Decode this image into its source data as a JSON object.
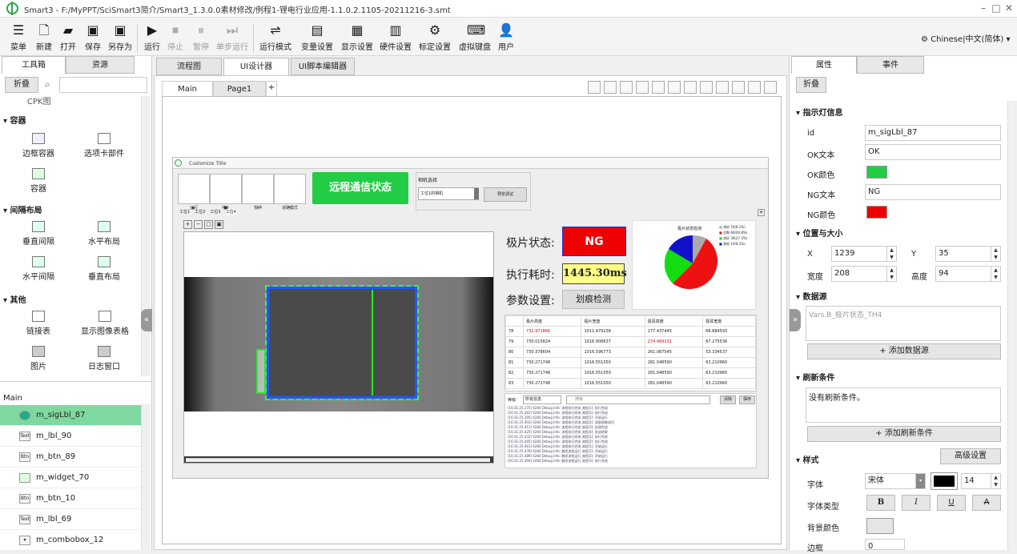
{
  "window": {
    "title": "Smart3 - F:/MyPPT/SciSmart3简介/Smart3_1.3.0.0素材修改/例程1-锂电行业应用-1.1.0.2.1105-20211216-3.smt"
  },
  "toolbar": [
    {
      "label": "菜单",
      "icon": "menu-icon"
    },
    {
      "label": "新建",
      "icon": "new-file-icon"
    },
    {
      "label": "打开",
      "icon": "folder-icon"
    },
    {
      "label": "保存",
      "icon": "save-icon"
    },
    {
      "label": "另存为",
      "icon": "save-as-icon"
    },
    {
      "label": "运行",
      "icon": "play-icon"
    },
    {
      "label": "停止",
      "icon": "stop-icon"
    },
    {
      "label": "暂停",
      "icon": "pause-icon"
    },
    {
      "label": "单步运行",
      "icon": "step-icon"
    },
    {
      "label": "运行模式",
      "icon": "run-mode-icon"
    },
    {
      "label": "变量设置",
      "icon": "var-icon"
    },
    {
      "label": "显示设置",
      "icon": "display-icon"
    },
    {
      "label": "硬件设置",
      "icon": "hardware-icon"
    },
    {
      "label": "标定设置",
      "icon": "calib-icon"
    },
    {
      "label": "虚拟键盘",
      "icon": "keyboard-icon"
    },
    {
      "label": "用户",
      "icon": "user-icon"
    }
  ],
  "language": "Chinese|中文(简体)",
  "left": {
    "tabs": [
      "工具箱",
      "资源"
    ],
    "fold_label": "折叠",
    "search_placeholder": "",
    "top_cut": "CPK图",
    "groups": [
      {
        "name": "容器",
        "items": [
          "边框容器",
          "选项卡部件",
          "容器"
        ]
      },
      {
        "name": "间隔布局",
        "items": [
          "垂直间隔",
          "水平布局",
          "水平间隔",
          "垂直布局"
        ]
      },
      {
        "name": "其他",
        "items": [
          "链接表",
          "显示图像表格",
          "图片",
          "日志窗口"
        ]
      }
    ],
    "layer_title": "Main",
    "layers": [
      {
        "name": "m_sigLbl_87",
        "type": "light",
        "selected": true
      },
      {
        "name": "m_lbl_90",
        "type": "Text",
        "selected": false
      },
      {
        "name": "m_btn_89",
        "type": "Button",
        "selected": false
      },
      {
        "name": "m_widget_70",
        "type": "widget",
        "selected": false
      },
      {
        "name": "m_btn_10",
        "type": "Button",
        "selected": false
      },
      {
        "name": "m_lbl_69",
        "type": "Text",
        "selected": false
      },
      {
        "name": "m_combobox_12",
        "type": "combo",
        "selected": false
      }
    ]
  },
  "center": {
    "tabs": [
      "流程图",
      "UI设计器",
      "UI脚本编辑器"
    ],
    "active_tab": "UI设计器",
    "pages": [
      "Main",
      "Page1"
    ],
    "form": {
      "title": "Customize Title",
      "buttons": [
        "运行",
        "停止",
        "暂停",
        "道路模式"
      ],
      "remote_label": "远程通信状态",
      "camera_group": "相机选择",
      "camera_value": "工位1的相机",
      "camera_btn": "预览调试",
      "subtabs": [
        "工位1",
        "工位2",
        "工位3",
        "工位4"
      ],
      "labels": {
        "status": "极片状态:",
        "time": "执行耗时:",
        "param": "参数设置:"
      },
      "ng": "NG",
      "time_value": "1445.30ms",
      "measure_btn": "划痕检测",
      "pie_title": "极片状态检测",
      "pie_legend": [
        "良好 10(8.1%)",
        "总数 60(64.8%)",
        "良好 30(27.3%)",
        "其他 10(8.1%)"
      ],
      "table": {
        "headers": [
          "",
          "极片高度",
          "极片宽度",
          "极耳高度",
          "极耳宽度"
        ],
        "rows": [
          [
            "78",
            "732.971866",
            "1011.979238",
            "277.437445",
            "66.884593"
          ],
          [
            "79",
            "730.015824",
            "1016.908637",
            "274.469131",
            "67.275536"
          ],
          [
            "80",
            "730.378604",
            "1016.596773",
            "261.087545",
            "53.334537"
          ],
          [
            "81",
            "730.271748",
            "1016.551050",
            "281.048590",
            "63.210960"
          ],
          [
            "82",
            "730.271748",
            "1016.551050",
            "281.048590",
            "63.210960"
          ],
          [
            "83",
            "730.271748",
            "1016.551050",
            "281.048590",
            "63.210960"
          ]
        ]
      },
      "log_filter_label": "等级:",
      "log_filter_value": "所有信息",
      "log_search_placeholder": "搜索",
      "log_btn1": "清除",
      "log_btn2": "保存",
      "log_lines": [
        "[16:31:25.275] 4284 Debug Info: 流程执行完成 流程[1]: 执行完成",
        "[16:31:25.281] 4284 Debug Info: 流程执行完成 流程[2]: 执行完成",
        "[16:31:25.395] 4284 Debug Info: 流程执行完成 流程[1]: 开始运行",
        "[16:31:25.402] 4284 Debug Info: 流程执行完成 流程[2]: 获取图像成功",
        "[16:31:25.411] 4284 Debug Info: 流程执行完成 流程[3]: 处理完成",
        "[16:31:25.425] 4284 Debug Info: 流程执行完成 流程[4]: 发送结果",
        "[16:31:25.432] 4284 Debug Info: 流程执行完成 流程[1]: 执行完成",
        "[16:31:25.445] 4284 Debug Info: 流程执行完成 流程[2]: 执行完成",
        "[16:31:25.461] 4284 Debug Info: 流程执行完成 流程[1]: 开始运行",
        "[16:31:25.478] 4284 Debug Info: 触发流程运行 流程[1]: 开始运行",
        "[16:31:25.489] 4284 Debug Info: 触发流程运行 流程[2]: 开始运行",
        "[16:31:25.494] 4284 Debug Info: 触发流程运行 流程[3]: 执行完成"
      ]
    }
  },
  "right": {
    "tabs": [
      "属性",
      "事件"
    ],
    "fold_label": "折叠",
    "sections": {
      "indicator": "指示灯信息",
      "posSize": "位置与大小",
      "datasource": "数据源",
      "refresh": "刷新条件",
      "style": "样式"
    },
    "fields": {
      "id_label": "id",
      "id_value": "m_sigLbl_87",
      "ok_text_label": "OK文本",
      "ok_text_value": "OK",
      "ok_color_label": "OK颜色",
      "ok_color": "#22cc44",
      "ng_text_label": "NG文本",
      "ng_text_value": "NG",
      "ng_color_label": "NG颜色",
      "ng_color": "#ee0000",
      "x_label": "X",
      "x_value": "1239",
      "y_label": "Y",
      "y_value": "35",
      "w_label": "宽度",
      "w_value": "208",
      "h_label": "高度",
      "h_value": "94",
      "datasource_value": "Vars.B_极片状态_TH4",
      "add_datasource": "+ 添加数据源",
      "refresh_value": "没有刷新条件。",
      "add_refresh": "+ 添加刷新条件",
      "advanced": "高级设置",
      "font_label": "字体",
      "font_value": "宋体",
      "font_size": "14",
      "fonttype_label": "字体类型",
      "bg_label": "背景颜色",
      "border_label": "边框",
      "border_value": "0"
    }
  }
}
